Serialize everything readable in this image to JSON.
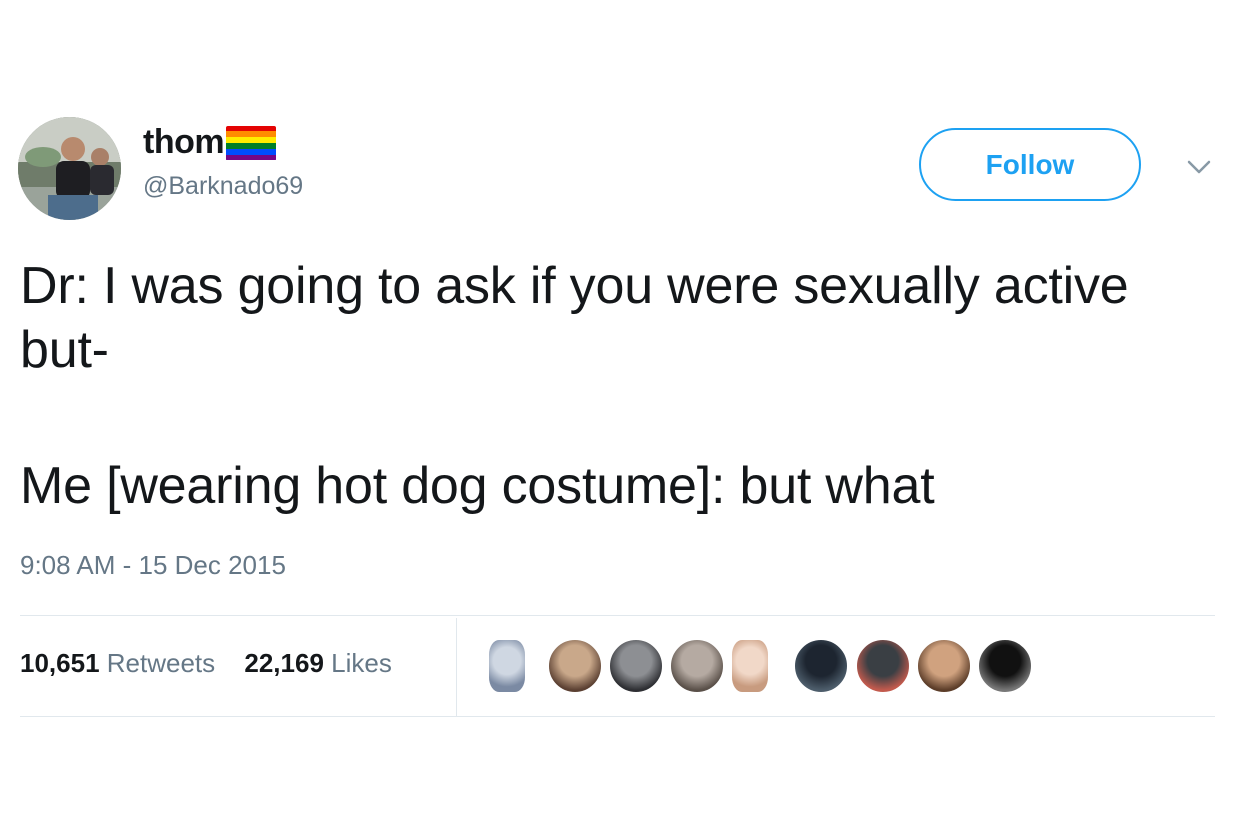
{
  "user": {
    "display_name": "thom",
    "handle": "@Barknado69",
    "avatar_icon": "avatar-photo",
    "flag_icon": "rainbow-flag",
    "flag_colors": [
      "#e40303",
      "#ff8c00",
      "#ffed00",
      "#008026",
      "#004dff",
      "#750787"
    ]
  },
  "actions": {
    "follow_label": "Follow",
    "menu_icon": "chevron-down-icon"
  },
  "tweet": {
    "line_1": "Dr: I was going to ask if you were sexually active but-",
    "line_2": "Me [wearing hot dog costume]: but what",
    "timestamp": "9:08 AM - 15 Dec 2015"
  },
  "stats": {
    "retweets_count": "10,651",
    "retweets_label": "Retweets",
    "likes_count": "22,169",
    "likes_label": "Likes"
  },
  "likers": [
    {
      "name": "liker-avatar-1",
      "colors": [
        "#cfd7e2",
        "#7b8aa3"
      ]
    },
    {
      "name": "liker-avatar-2",
      "colors": [
        "#c9a88a",
        "#5b4032"
      ]
    },
    {
      "name": "liker-avatar-3",
      "colors": [
        "#8d8f93",
        "#2e2f33"
      ]
    },
    {
      "name": "liker-avatar-4",
      "colors": [
        "#b5aaa2",
        "#5a5049"
      ]
    },
    {
      "name": "liker-avatar-5",
      "colors": [
        "#f1d8c8",
        "#c89b7f"
      ]
    },
    {
      "name": "liker-avatar-6",
      "colors": [
        "#1d2530",
        "#4d5d6b"
      ]
    },
    {
      "name": "liker-avatar-7",
      "colors": [
        "#3a3f44",
        "#c25a4d"
      ]
    },
    {
      "name": "liker-avatar-8",
      "colors": [
        "#d0a27f",
        "#5c3d29"
      ]
    },
    {
      "name": "liker-avatar-9",
      "colors": [
        "#111111",
        "#777777"
      ]
    }
  ],
  "colors": {
    "accent": "#1da1f2",
    "text": "#14171a",
    "muted": "#657786",
    "divider": "#e1e8ed"
  }
}
